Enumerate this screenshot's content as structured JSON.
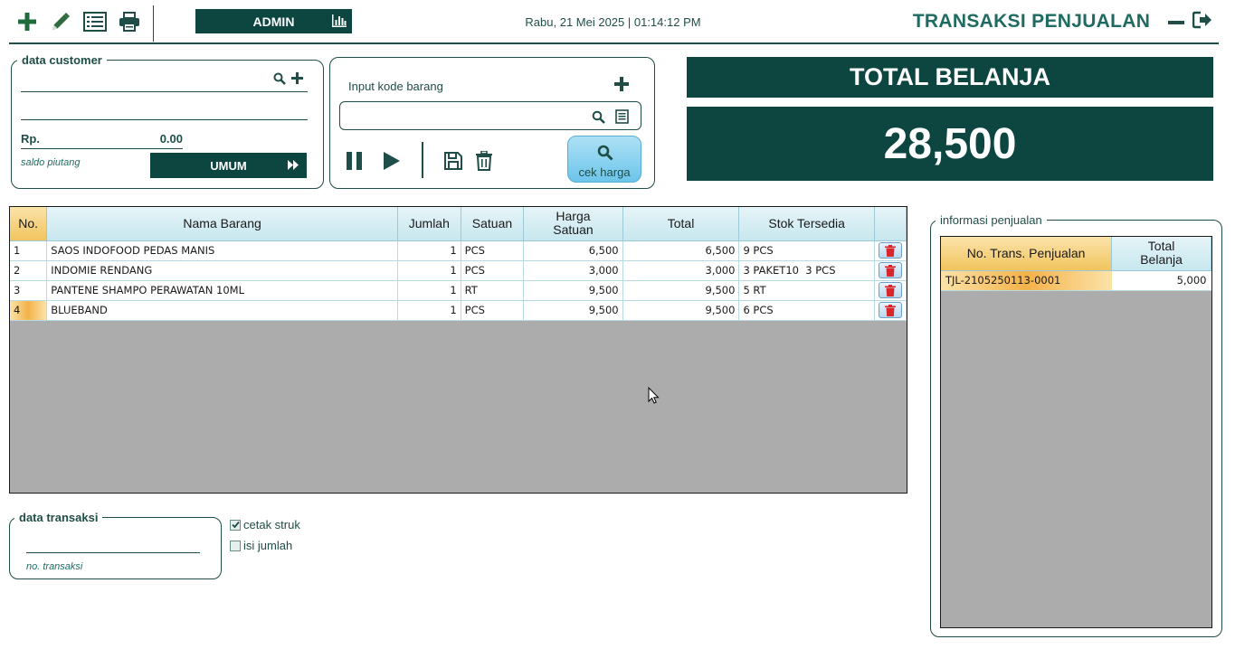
{
  "toolbar": {
    "icons": [
      "plus-icon",
      "pencil-icon",
      "list-icon",
      "printer-icon"
    ],
    "admin_label": "ADMIN",
    "datetime": "Rabu, 21 Mei 2025 | 01:14:12 PM",
    "page_title": "TRANSAKSI PENJUALAN"
  },
  "customer": {
    "legend": "data customer",
    "rp_label": "Rp.",
    "rp_value": "0.00",
    "saldo_label": "saldo piutang",
    "umum_label": "UMUM"
  },
  "kode": {
    "label": "Input kode barang",
    "input_value": "",
    "cek_harga_label": "cek harga"
  },
  "total": {
    "heading": "TOTAL BELANJA",
    "value": "28,500"
  },
  "grid": {
    "headers": [
      "No.",
      "Nama Barang",
      "Jumlah",
      "Satuan",
      "Harga Satuan",
      "Total",
      "Stok Tersedia",
      ""
    ],
    "rows": [
      {
        "no": "1",
        "nama": "SAOS INDOFOOD PEDAS MANIS",
        "jumlah": "1",
        "satuan": "PCS",
        "harga": "6,500",
        "total": "6,500",
        "stok": "9 PCS"
      },
      {
        "no": "2",
        "nama": "INDOMIE RENDANG",
        "jumlah": "1",
        "satuan": "PCS",
        "harga": "3,000",
        "total": "3,000",
        "stok": "3 PAKET10  3 PCS"
      },
      {
        "no": "3",
        "nama": "PANTENE SHAMPO PERAWATAN 10ML",
        "jumlah": "1",
        "satuan": "RT",
        "harga": "9,500",
        "total": "9,500",
        "stok": "5 RT"
      },
      {
        "no": "4",
        "nama": "BLUEBAND",
        "jumlah": "1",
        "satuan": "PCS",
        "harga": "9,500",
        "total": "9,500",
        "stok": "6 PCS"
      }
    ],
    "selected_row_index": 3
  },
  "transaksi": {
    "legend": "data transaksi",
    "no_transaksi_value": "",
    "no_transaksi_label": "no. transaksi",
    "cetak_struk_label": "cetak struk",
    "cetak_struk_checked": true,
    "isi_jumlah_label": "isi jumlah",
    "isi_jumlah_checked": false
  },
  "info": {
    "legend": "informasi penjualan",
    "headers": [
      "No. Trans. Penjualan",
      "Total Belanja"
    ],
    "rows": [
      {
        "no_trans": "TJL-2105250113-0001",
        "total": "5,000"
      }
    ]
  },
  "colors": {
    "dark_teal": "#0d4540",
    "text_teal": "#1f4d47",
    "title_teal": "#1f6b61",
    "header_gold": "#f1c45e",
    "header_blue": "#c7e7ef",
    "delete_red": "#d9262a",
    "grid_bg": "#acacac"
  }
}
